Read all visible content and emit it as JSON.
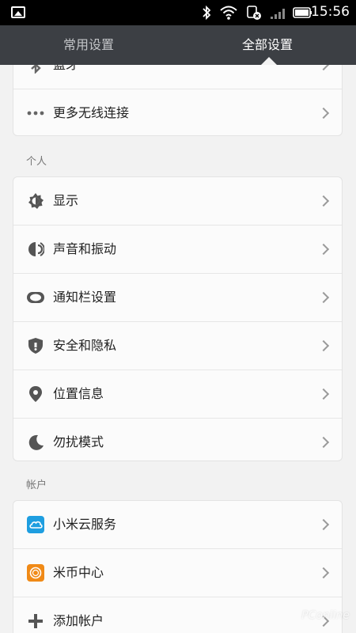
{
  "status_bar": {
    "time": "15:56"
  },
  "tabs": {
    "common": "常用设置",
    "all": "全部设置"
  },
  "sections": {
    "wireless": {
      "items": [
        {
          "label": "蓝牙",
          "icon": "bluetooth-icon"
        },
        {
          "label": "更多无线连接",
          "icon": "more-dots-icon"
        }
      ]
    },
    "personal": {
      "title": "个人",
      "items": [
        {
          "label": "显示",
          "icon": "brightness-icon"
        },
        {
          "label": "声音和振动",
          "icon": "speaker-icon"
        },
        {
          "label": "通知栏设置",
          "icon": "toggle-icon"
        },
        {
          "label": "安全和隐私",
          "icon": "shield-icon"
        },
        {
          "label": "位置信息",
          "icon": "location-pin-icon"
        },
        {
          "label": "勿扰模式",
          "icon": "moon-icon"
        }
      ]
    },
    "accounts": {
      "title": "帐户",
      "items": [
        {
          "label": "小米云服务",
          "icon": "cloud-icon"
        },
        {
          "label": "米币中心",
          "icon": "coin-icon"
        },
        {
          "label": "添加帐户",
          "icon": "plus-icon"
        }
      ]
    }
  },
  "watermark": "PConline"
}
